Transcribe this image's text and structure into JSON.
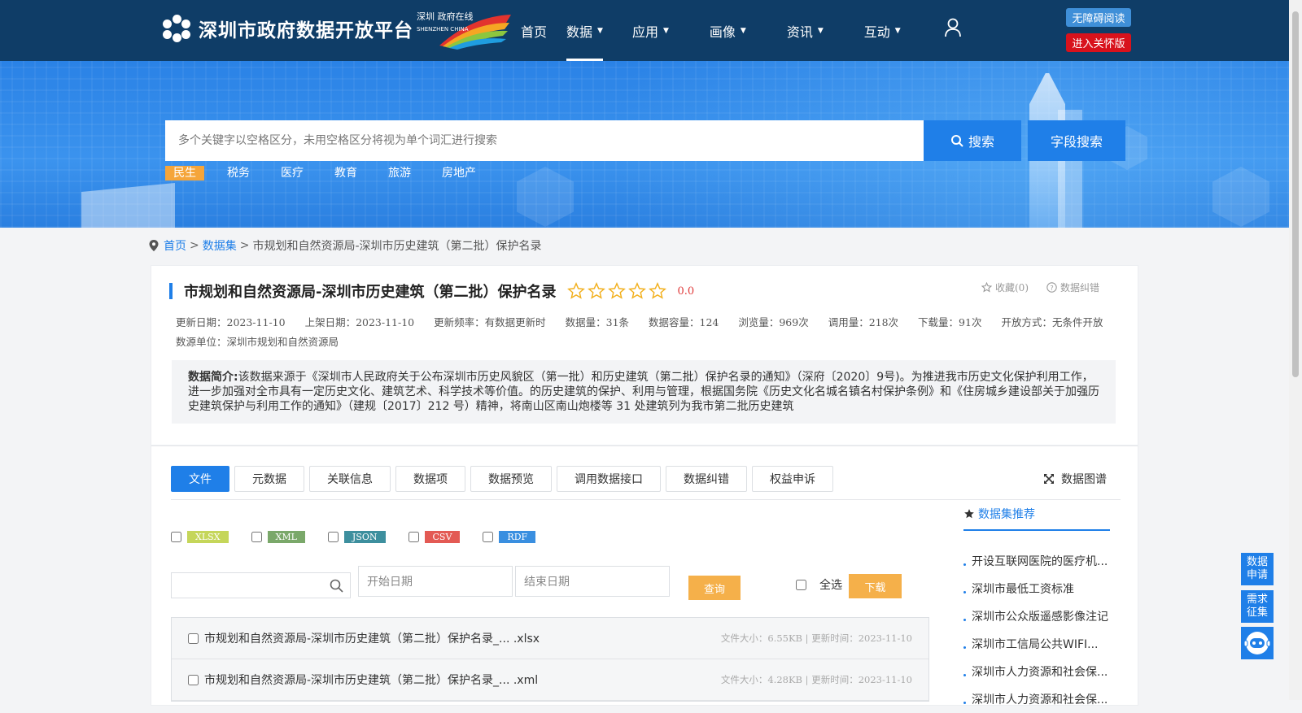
{
  "header": {
    "site_title": "深圳市政府数据开放平台",
    "badge_text": "深圳 政府在线",
    "badge_sub": "SHENZHEN CHINA",
    "nav": [
      {
        "label": "首页",
        "has_caret": false
      },
      {
        "label": "数据",
        "has_caret": true
      },
      {
        "label": "应用",
        "has_caret": true
      },
      {
        "label": "画像",
        "has_caret": true
      },
      {
        "label": "资讯",
        "has_caret": true
      },
      {
        "label": "互动",
        "has_caret": true
      }
    ],
    "access_label": "无障碍阅读",
    "care_label": "进入关怀版",
    "colors": {
      "nav_bg": "#0f3d67",
      "accent": "#1f7fe8",
      "care": "#d8121c",
      "orange": "#f5b04a"
    }
  },
  "search": {
    "placeholder": "多个关键字以空格区分，未用空格区分将视为单个词汇进行搜索",
    "search_label": "搜索",
    "field_search_label": "字段搜索",
    "hot_tags": [
      "民生",
      "税务",
      "医疗",
      "教育",
      "旅游",
      "房地产"
    ]
  },
  "breadcrumb": {
    "home": "首页",
    "sep": ">",
    "datasets": "数据集",
    "current": "市规划和自然资源局-深圳市历史建筑（第二批）保护名录"
  },
  "dataset": {
    "title": "市规划和自然资源局-深圳市历史建筑（第二批）保护名录",
    "rating": "0.0",
    "favorite": "收藏(0)",
    "correction": "数据纠错",
    "meta": [
      "更新日期：2023-11-10",
      "上架日期：2023-11-10",
      "更新频率：有数据更新时",
      "数据量：31条",
      "数据容量：124",
      "浏览量：969次",
      "调用量：218次",
      "下载量：91次",
      "开放方式：无条件开放",
      "数源单位：深圳市规划和自然资源局"
    ],
    "summary_label": "数据简介:",
    "summary": "该数据来源于《深圳市人民政府关于公布深圳市历史风貌区（第一批）和历史建筑（第二批）保护名录的通知》（深府〔2020〕9号)。为推进我市历史文化保护利用工作，进一步加强对全市具有一定历史文化、建筑艺术、科学技术等价值。的历史建筑的保护、利用与管理，根据国务院《历史文化名城名镇名村保护条例》和《住房城乡建设部关于加强历史建筑保护与利用工作的通知》（建规〔2017〕212 号）精神，将南山区南山炮楼等 31 处建筑列为我市第二批历史建筑"
  },
  "tabs": [
    "文件",
    "元数据",
    "关联信息",
    "数据项",
    "数据预览",
    "调用数据接口",
    "数据纠错",
    "权益申诉"
  ],
  "graph_label": "数据图谱",
  "formats": [
    {
      "label": "XLSX",
      "color": "#c5d65a"
    },
    {
      "label": "XML",
      "color": "#7aa86a"
    },
    {
      "label": "JSON",
      "color": "#3d8f9e"
    },
    {
      "label": "CSV",
      "color": "#e35a54"
    },
    {
      "label": "RDF",
      "color": "#3a8fe0"
    }
  ],
  "filters": {
    "start_date": "开始日期",
    "end_date": "结束日期",
    "query_label": "查询",
    "select_all_label": "全选",
    "download_label": "下载"
  },
  "files": [
    {
      "name": "市规划和自然资源局-深圳市历史建筑（第二批）保护名录_... .xlsx",
      "meta": "文件大小：6.55KB | 更新时间：2023-11-10"
    },
    {
      "name": "市规划和自然资源局-深圳市历史建筑（第二批）保护名录_... .xml",
      "meta": "文件大小：4.28KB | 更新时间：2023-11-10"
    }
  ],
  "recommend": {
    "title": "数据集推荐",
    "items": [
      "开设互联网医院的医疗机...",
      "深圳市最低工资标准",
      "深圳市公众版遥感影像注记",
      "深圳市工信局公共WIFI...",
      "深圳市人力资源和社会保...",
      "深圳市人力资源和社会保..."
    ]
  },
  "float_buttons": [
    "数据\n申请",
    "需求\n征集"
  ]
}
